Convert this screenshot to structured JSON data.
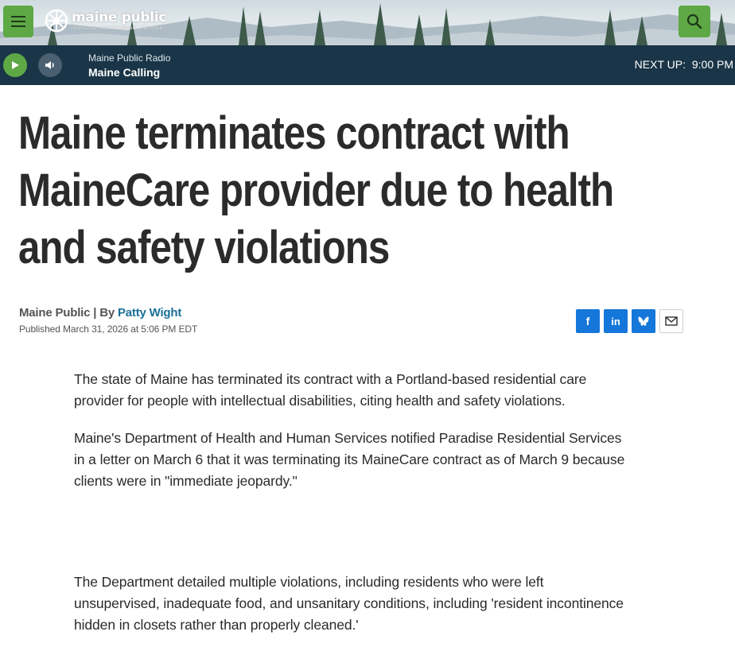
{
  "header": {
    "menu_icon": "hamburger-menu-icon",
    "logo_name": "maine public",
    "logo_tagline": "INSPIRING · ENTERTAINING · TRUSTED",
    "search_icon": "search-icon",
    "accent_color": "#5ea846"
  },
  "player": {
    "play_icon": "play-icon",
    "volume_icon": "volume-icon",
    "station": "Maine Public Radio",
    "program": "Maine Calling",
    "next_up_label": "NEXT UP:",
    "next_up_time": "9:00 PM",
    "background_color": "#1a3547"
  },
  "article": {
    "headline": "Maine terminates contract with MaineCare provider due to health and safety violations",
    "source": "Maine Public",
    "by_separator": " | By ",
    "author": "Patty Wight",
    "published": "Published March 31, 2026 at 5:06 PM EDT",
    "share": {
      "facebook_label": "f",
      "linkedin_label": "in",
      "icons": [
        "facebook-icon",
        "linkedin-icon",
        "bluesky-icon",
        "email-icon"
      ]
    },
    "paragraphs": [
      "The state of Maine has terminated its contract with a Portland-based residential care provider for people with intellectual disabilities, citing health and safety violations.",
      "Maine's Department of Health and Human Services notified Paradise Residential Services in a letter on March 6 that it was terminating its MaineCare contract as of March 9 because clients were in \"immediate jeopardy.\"",
      "The Department detailed multiple violations, including residents who were left unsupervised, inadequate food, and unsanitary conditions, including 'resident incontinence hidden in closets rather than properly cleaned.'"
    ]
  }
}
